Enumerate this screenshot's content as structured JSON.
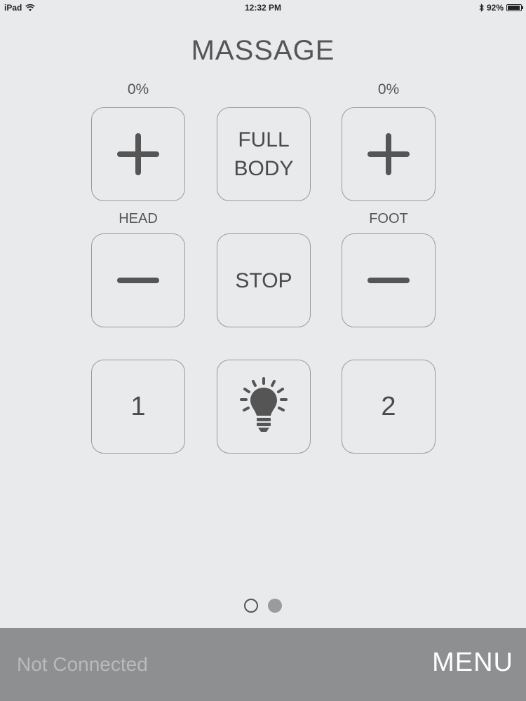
{
  "status_bar": {
    "device": "iPad",
    "time": "12:32 PM",
    "battery": "92%",
    "battery_level": 0.92,
    "icons": [
      "wifi-icon",
      "bluetooth-icon",
      "battery-icon"
    ]
  },
  "title": "MASSAGE",
  "head": {
    "percent": "0%",
    "label": "HEAD"
  },
  "foot": {
    "percent": "0%",
    "label": "FOOT"
  },
  "buttons": {
    "full_body_line1": "FULL",
    "full_body_line2": "BODY",
    "stop": "STOP",
    "preset1": "1",
    "preset2": "2"
  },
  "icons": {
    "head_up": "plus-icon",
    "head_down": "minus-icon",
    "foot_up": "plus-icon",
    "foot_down": "minus-icon",
    "light": "light-bulb-icon"
  },
  "pager": {
    "current": 2,
    "total": 2
  },
  "bottom_bar": {
    "connection_status": "Not Connected",
    "menu_label": "MENU"
  }
}
